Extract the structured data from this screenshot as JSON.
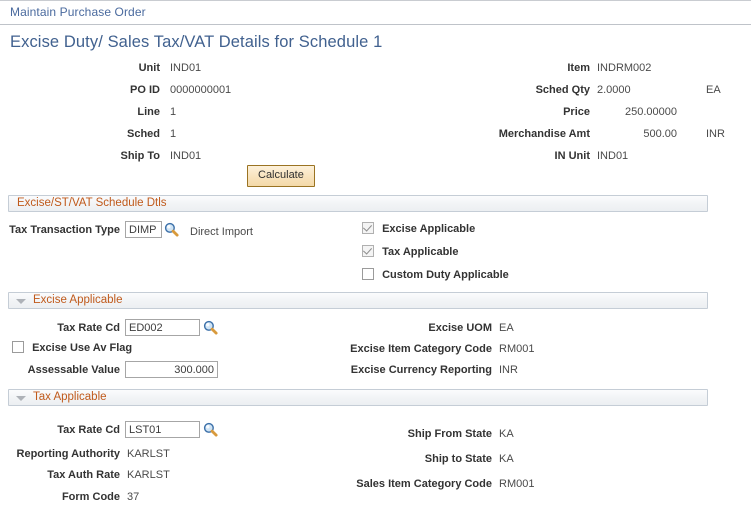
{
  "breadcrumb": {
    "label": "Maintain Purchase Order"
  },
  "page_title": "Excise Duty/ Sales Tax/VAT Details for Schedule 1",
  "header": {
    "left": [
      {
        "label": "Unit",
        "value": "IND01"
      },
      {
        "label": "PO ID",
        "value": "0000000001"
      },
      {
        "label": "Line",
        "value": "1"
      },
      {
        "label": "Sched",
        "value": "1"
      },
      {
        "label": "Ship To",
        "value": "IND01"
      }
    ],
    "right": [
      {
        "label": "Item",
        "value": "INDRM002",
        "unit": ""
      },
      {
        "label": "Sched Qty",
        "value": "2.0000",
        "unit": "EA"
      },
      {
        "label": "Price",
        "value": "250.00000",
        "unit": ""
      },
      {
        "label": "Merchandise Amt",
        "value": "500.00",
        "unit": "INR"
      },
      {
        "label": "IN Unit",
        "value": "IND01",
        "unit": ""
      }
    ],
    "calculate_button": "Calculate"
  },
  "schedule_section": {
    "title": "Excise/ST/VAT Schedule Dtls",
    "tax_transaction_type_label": "Tax Transaction Type",
    "tax_transaction_type_value": "DIMP",
    "tax_transaction_type_desc": "Direct Import",
    "checkboxes": [
      {
        "label": "Excise Applicable",
        "checked": true,
        "enabled": false
      },
      {
        "label": "Tax Applicable",
        "checked": true,
        "enabled": false
      },
      {
        "label": "Custom Duty Applicable",
        "checked": false,
        "enabled": true
      }
    ]
  },
  "excise_section": {
    "title": "Excise Applicable",
    "tax_rate_cd_label": "Tax Rate Cd",
    "tax_rate_cd_value": "ED002",
    "use_av_flag_label": "Excise Use Av Flag",
    "use_av_flag_checked": false,
    "assessable_value_label": "Assessable Value",
    "assessable_value": "300.000",
    "right_fields": [
      {
        "label": "Excise UOM",
        "value": "EA"
      },
      {
        "label": "Excise Item Category Code",
        "value": "RM001"
      },
      {
        "label": "Excise Currency Reporting",
        "value": "INR"
      }
    ]
  },
  "tax_section": {
    "title": "Tax Applicable",
    "tax_rate_cd_label": "Tax Rate Cd",
    "tax_rate_cd_value": "LST01",
    "left_fields": [
      {
        "label": "Reporting Authority",
        "value": "KARLST"
      },
      {
        "label": "Tax Auth Rate",
        "value": "KARLST"
      },
      {
        "label": "Form Code",
        "value": "37"
      }
    ],
    "right_fields": [
      {
        "label": "Ship From State",
        "value": "KA"
      },
      {
        "label": "Ship to State",
        "value": "KA"
      },
      {
        "label": "Sales Item Category Code",
        "value": "RM001"
      }
    ]
  },
  "icons": {
    "lookup": "search-lookup-icon"
  },
  "colors": {
    "title_blue": "#41618f",
    "link_blue": "#4a6a9e",
    "section_orange": "#c05a1c",
    "button_border": "#9a7322"
  }
}
